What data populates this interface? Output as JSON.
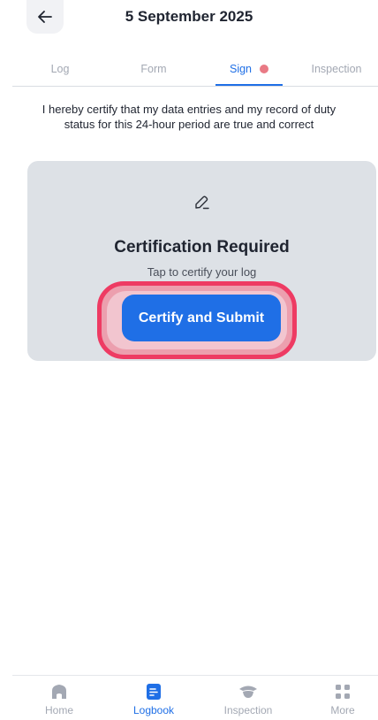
{
  "header": {
    "title": "5 September 2025",
    "back_icon": "arrow-left-icon"
  },
  "tabs": [
    {
      "label": "Log",
      "active": false
    },
    {
      "label": "Form",
      "active": false
    },
    {
      "label": "Sign",
      "active": true,
      "has_alert": true
    },
    {
      "label": "Inspection",
      "active": false
    }
  ],
  "certification_statement": "I hereby certify that my data entries and my record of duty\nstatus for this 24-hour period are true and correct",
  "card": {
    "icon": "pen-icon",
    "title": "Certification Required",
    "subtitle": "Tap to certify your log",
    "button_label": "Certify and Submit"
  },
  "bottom_nav": [
    {
      "label": "Home",
      "icon": "home-icon",
      "active": false
    },
    {
      "label": "Logbook",
      "icon": "logbook-icon",
      "active": true
    },
    {
      "label": "Inspection",
      "icon": "inspection-hat-icon",
      "active": false
    },
    {
      "label": "More",
      "icon": "grid-icon",
      "active": false
    }
  ],
  "colors": {
    "accent": "#1f6fe6",
    "alert_dot": "#e97a85",
    "highlight_ring": "#ee3b63",
    "card_bg": "#dde1e6"
  }
}
